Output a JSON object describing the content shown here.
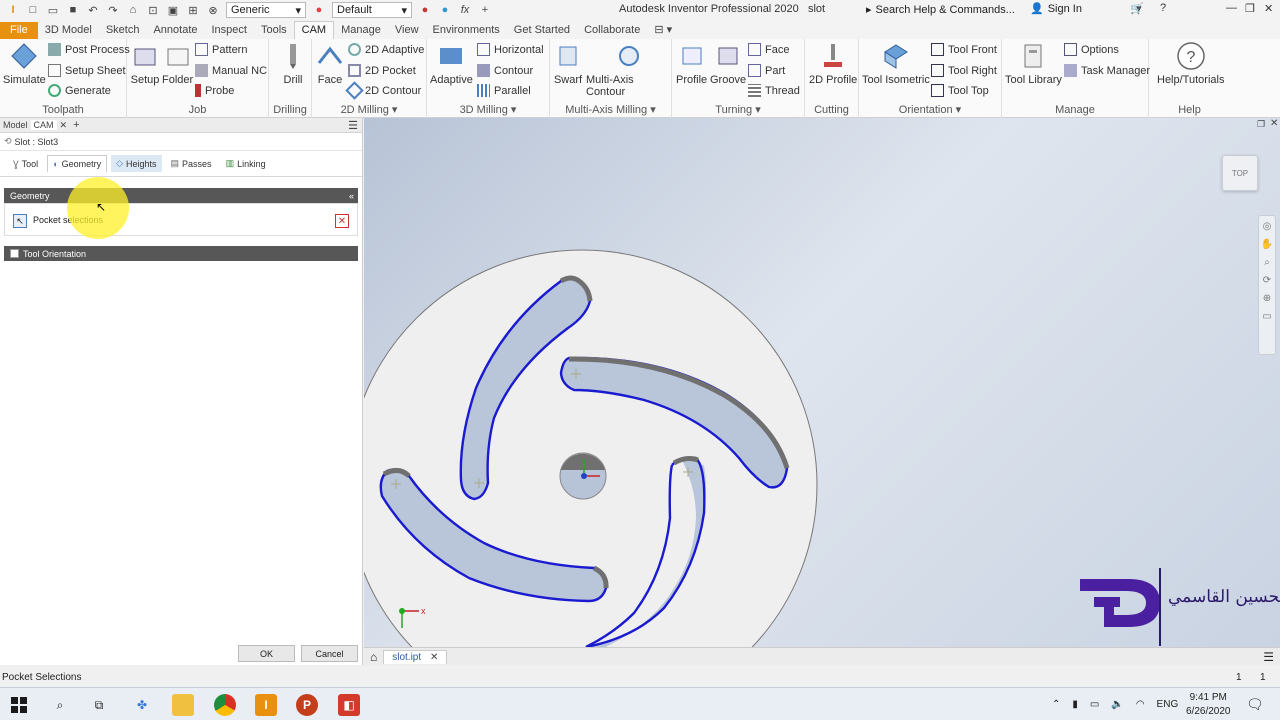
{
  "titlebar": {
    "appearance": "Generic",
    "display_style": "Default",
    "title": "Autodesk Inventor Professional 2020",
    "document": "slot",
    "search_placeholder": "Search Help & Commands...",
    "sign_in": "Sign In"
  },
  "menu": [
    "File",
    "3D Model",
    "Sketch",
    "Annotate",
    "Inspect",
    "Tools",
    "CAM",
    "Manage",
    "View",
    "Environments",
    "Get Started",
    "Collaborate"
  ],
  "menu_active": "CAM",
  "ribbon": {
    "toolpath": {
      "label": "Toolpath",
      "simulate": "Simulate",
      "post_process": "Post Process",
      "setup_sheet": "Setup Sheet",
      "generate": "Generate"
    },
    "job": {
      "label": "Job",
      "setup": "Setup",
      "folder": "Folder",
      "pattern": "Pattern",
      "manual_nc": "Manual NC",
      "probe": "Probe"
    },
    "drilling": {
      "label": "Drilling",
      "drill": "Drill"
    },
    "milling2d": {
      "label": "2D Milling",
      "face": "Face",
      "adaptive": "2D Adaptive",
      "pocket": "2D Pocket",
      "contour": "2D Contour"
    },
    "milling3d": {
      "label": "3D Milling",
      "adaptive": "Adaptive",
      "horizontal": "Horizontal",
      "contour": "Contour",
      "parallel": "Parallel"
    },
    "multiaxis": {
      "label": "Multi-Axis Milling",
      "swarf": "Swarf",
      "contour": "Multi-Axis Contour"
    },
    "turning": {
      "label": "Turning",
      "profile": "Profile",
      "groove": "Groove",
      "face": "Face",
      "part": "Part",
      "thread": "Thread"
    },
    "cutting": {
      "label": "Cutting",
      "profile": "2D Profile"
    },
    "orientation": {
      "label": "Orientation",
      "isometric": "Tool Isometric",
      "front": "Tool Front",
      "right": "Tool Right",
      "top": "Tool Top"
    },
    "manage": {
      "label": "Manage",
      "library": "Tool Library",
      "options": "Options",
      "task_manager": "Task Manager"
    },
    "help": {
      "label": "Help",
      "tutorials": "Help/Tutorials"
    }
  },
  "panel": {
    "tabs": [
      "Model",
      "CAM",
      "+"
    ],
    "breadcrumb": "Slot : Slot3",
    "op_tabs": [
      "Tool",
      "Geometry",
      "Heights",
      "Passes",
      "Linking"
    ],
    "op_tab_active": "Geometry",
    "geometry_header": "Geometry",
    "pocket_selections": "Pocket selections",
    "tool_orientation": "Tool Orientation",
    "ok": "OK",
    "cancel": "Cancel"
  },
  "viewcube": {
    "face": "TOP"
  },
  "doc_tab": "slot.ipt",
  "status": {
    "text": "Pocket Selections",
    "count1": "1",
    "count2": "1"
  },
  "taskbar": {
    "time": "9:41 PM",
    "date": "6/26/2020",
    "lang": "ENG"
  },
  "watermark": {
    "text": "الحسين القاسمي"
  }
}
